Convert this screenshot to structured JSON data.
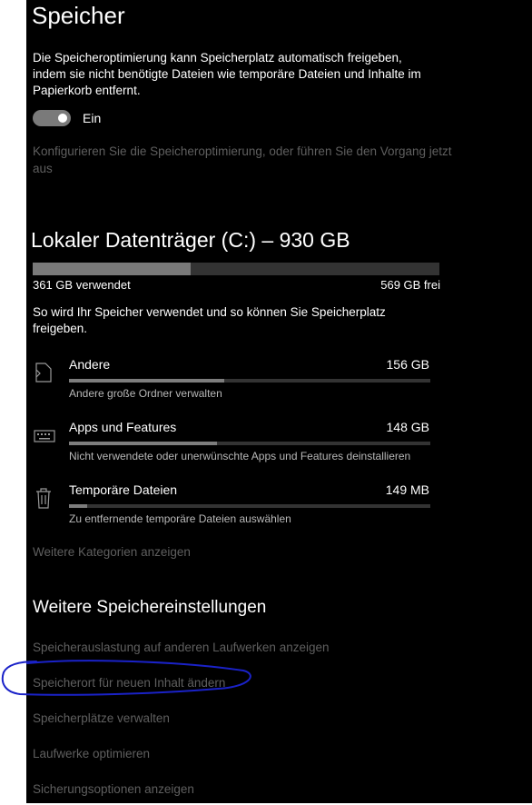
{
  "page": {
    "title": "Speicher",
    "description": "Die Speicheroptimierung kann Speicherplatz automatisch freigeben, indem sie nicht benötigte Dateien wie temporäre Dateien und Inhalte im Papierkorb entfernt.",
    "toggle": {
      "state_label": "Ein",
      "on": true
    },
    "configure_link": "Konfigurieren Sie die Speicheroptimierung, oder führen Sie den Vorgang jetzt aus"
  },
  "drive": {
    "title": "Lokaler Datenträger (C:) – 930 GB",
    "used_label": "361 GB verwendet",
    "free_label": "569 GB frei",
    "used_fraction": 0.388,
    "usage_description": "So wird Ihr Speicher verwendet und so können Sie Speicherplatz freigeben."
  },
  "categories": [
    {
      "name": "Andere",
      "size": "156 GB",
      "subtitle": "Andere große Ordner verwalten",
      "fraction": 0.43,
      "icon": "document-icon"
    },
    {
      "name": "Apps und Features",
      "size": "148 GB",
      "subtitle": "Nicht verwendete oder unerwünschte Apps und Features deinstallieren",
      "fraction": 0.41,
      "icon": "keyboard-icon"
    },
    {
      "name": "Temporäre Dateien",
      "size": "149 MB",
      "subtitle": "Zu entfernende temporäre Dateien auswählen",
      "fraction": 0.05,
      "icon": "trash-icon"
    }
  ],
  "more_categories_link": "Weitere Kategorien anzeigen",
  "more_settings": {
    "title": "Weitere Speichereinstellungen",
    "links": [
      "Speicherauslastung auf anderen Laufwerken anzeigen",
      "Speicherort für neuen Inhalt ändern",
      "Speicherplätze verwalten",
      "Laufwerke optimieren",
      "Sicherungsoptionen anzeigen"
    ]
  },
  "colors": {
    "background": "#000000",
    "text": "#ffffff",
    "link_dim": "#5f5f5f",
    "annotation": "#1a22c8"
  }
}
